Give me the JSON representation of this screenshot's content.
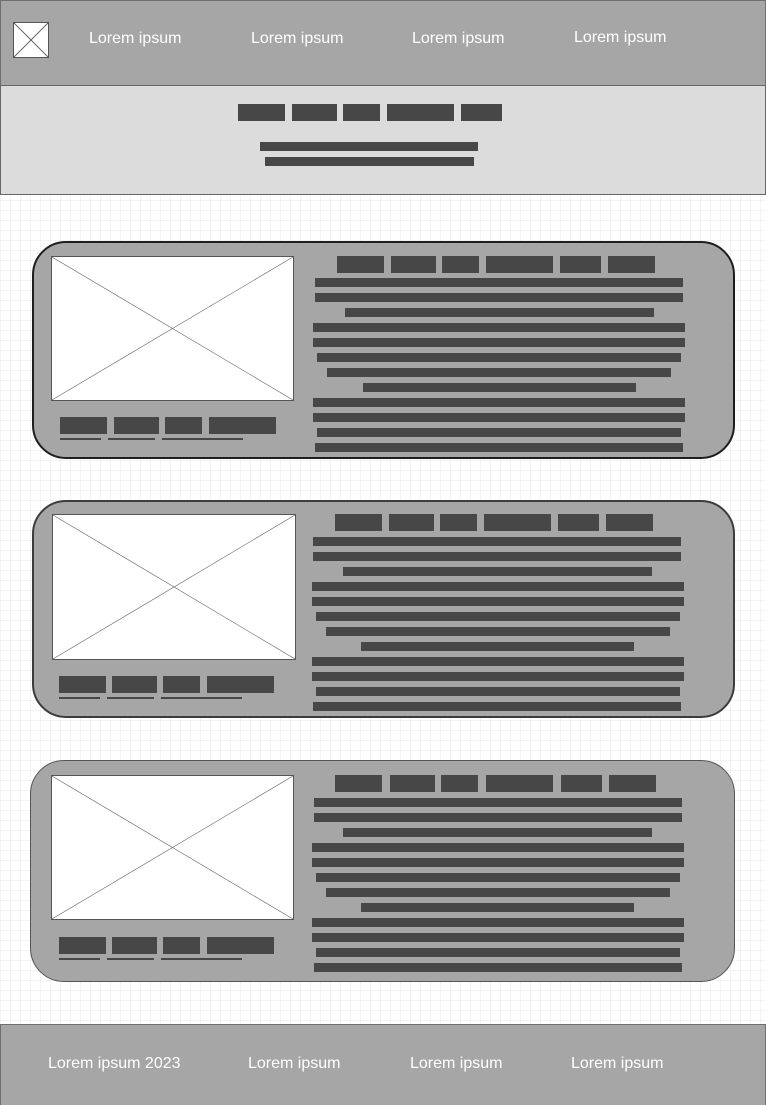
{
  "header": {
    "logo_icon": "image-placeholder-icon",
    "nav": [
      {
        "label": "Lorem ipsum"
      },
      {
        "label": "Lorem ipsum"
      },
      {
        "label": "Lorem ipsum"
      },
      {
        "label": "Lorem ipsum"
      }
    ]
  },
  "cards": [
    {
      "image_icon": "image-placeholder-icon"
    },
    {
      "image_icon": "image-placeholder-icon"
    },
    {
      "image_icon": "image-placeholder-icon"
    }
  ],
  "footer": {
    "links": [
      {
        "label": "Lorem ipsum 2023"
      },
      {
        "label": "Lorem ipsum"
      },
      {
        "label": "Lorem ipsum"
      },
      {
        "label": "Lorem ipsum"
      }
    ]
  },
  "colors": {
    "bar_gray": "#a6a6a6",
    "hero_gray": "#dcdcdc",
    "text_block": "#474747",
    "link_text": "#ffffff"
  }
}
